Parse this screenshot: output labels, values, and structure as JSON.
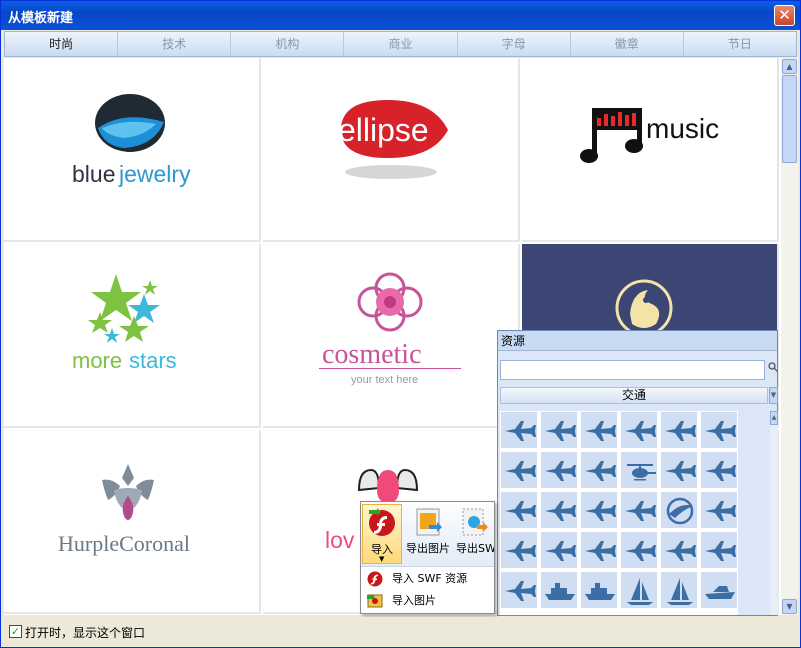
{
  "window": {
    "title": "从模板新建",
    "close_glyph": "✕"
  },
  "tabs": [
    {
      "label": "时尚",
      "active": true
    },
    {
      "label": "技术",
      "active": false
    },
    {
      "label": "机构",
      "active": false
    },
    {
      "label": "商业",
      "active": false
    },
    {
      "label": "字母",
      "active": false
    },
    {
      "label": "徽章",
      "active": false
    },
    {
      "label": "节日",
      "active": false
    }
  ],
  "templates": [
    {
      "name": "bluejewelry",
      "part1": "blue",
      "part2": "jewelry"
    },
    {
      "name": "ellipse",
      "text": "ellipse"
    },
    {
      "name": "music",
      "text": "music"
    },
    {
      "name": "morestars",
      "part1": "more",
      "part2": "stars"
    },
    {
      "name": "cosmetic",
      "text": "cosmetic",
      "tagline": "your text here"
    },
    {
      "name": "dark-emblem"
    },
    {
      "name": "HurpleCoronal",
      "text": "HurpleCoronal"
    },
    {
      "name": "love",
      "text": "lov"
    }
  ],
  "status": {
    "show_on_open_label": "打开时，显示这个窗口",
    "checked": true
  },
  "resource_panel": {
    "title": "资源",
    "search_value": "",
    "category": "交通",
    "icon_color": "#3a6ea5",
    "items": [
      "airplane-icon",
      "airplane-icon",
      "airplane-icon",
      "airplane-icon",
      "airplane-icon",
      "airplane-icon",
      "airplane-icon",
      "airplane-icon",
      "airplane-icon",
      "helicopter-icon",
      "airplane-icon",
      "airplane-icon",
      "airplane-icon",
      "airplane-icon",
      "airplane-icon",
      "airplane-icon",
      "airline-logo-icon",
      "airplane-icon",
      "airplane-icon",
      "airplane-icon",
      "airplane-icon",
      "airplane-icon",
      "airplane-icon",
      "airplane-icon",
      "airplane-icon",
      "ship-icon",
      "ship-icon",
      "sailboat-icon",
      "sailboat-icon",
      "speedboat-icon"
    ]
  },
  "import_popup": {
    "import_label": "导入",
    "export_image_label": "导出图片",
    "export_swf_label": "导出SWF",
    "import_swf_label": "导入 SWF 资源",
    "import_image_label": "导入图片"
  },
  "colors": {
    "brand_blue": "#0a52d6",
    "dark_cell": "#3b4674"
  }
}
